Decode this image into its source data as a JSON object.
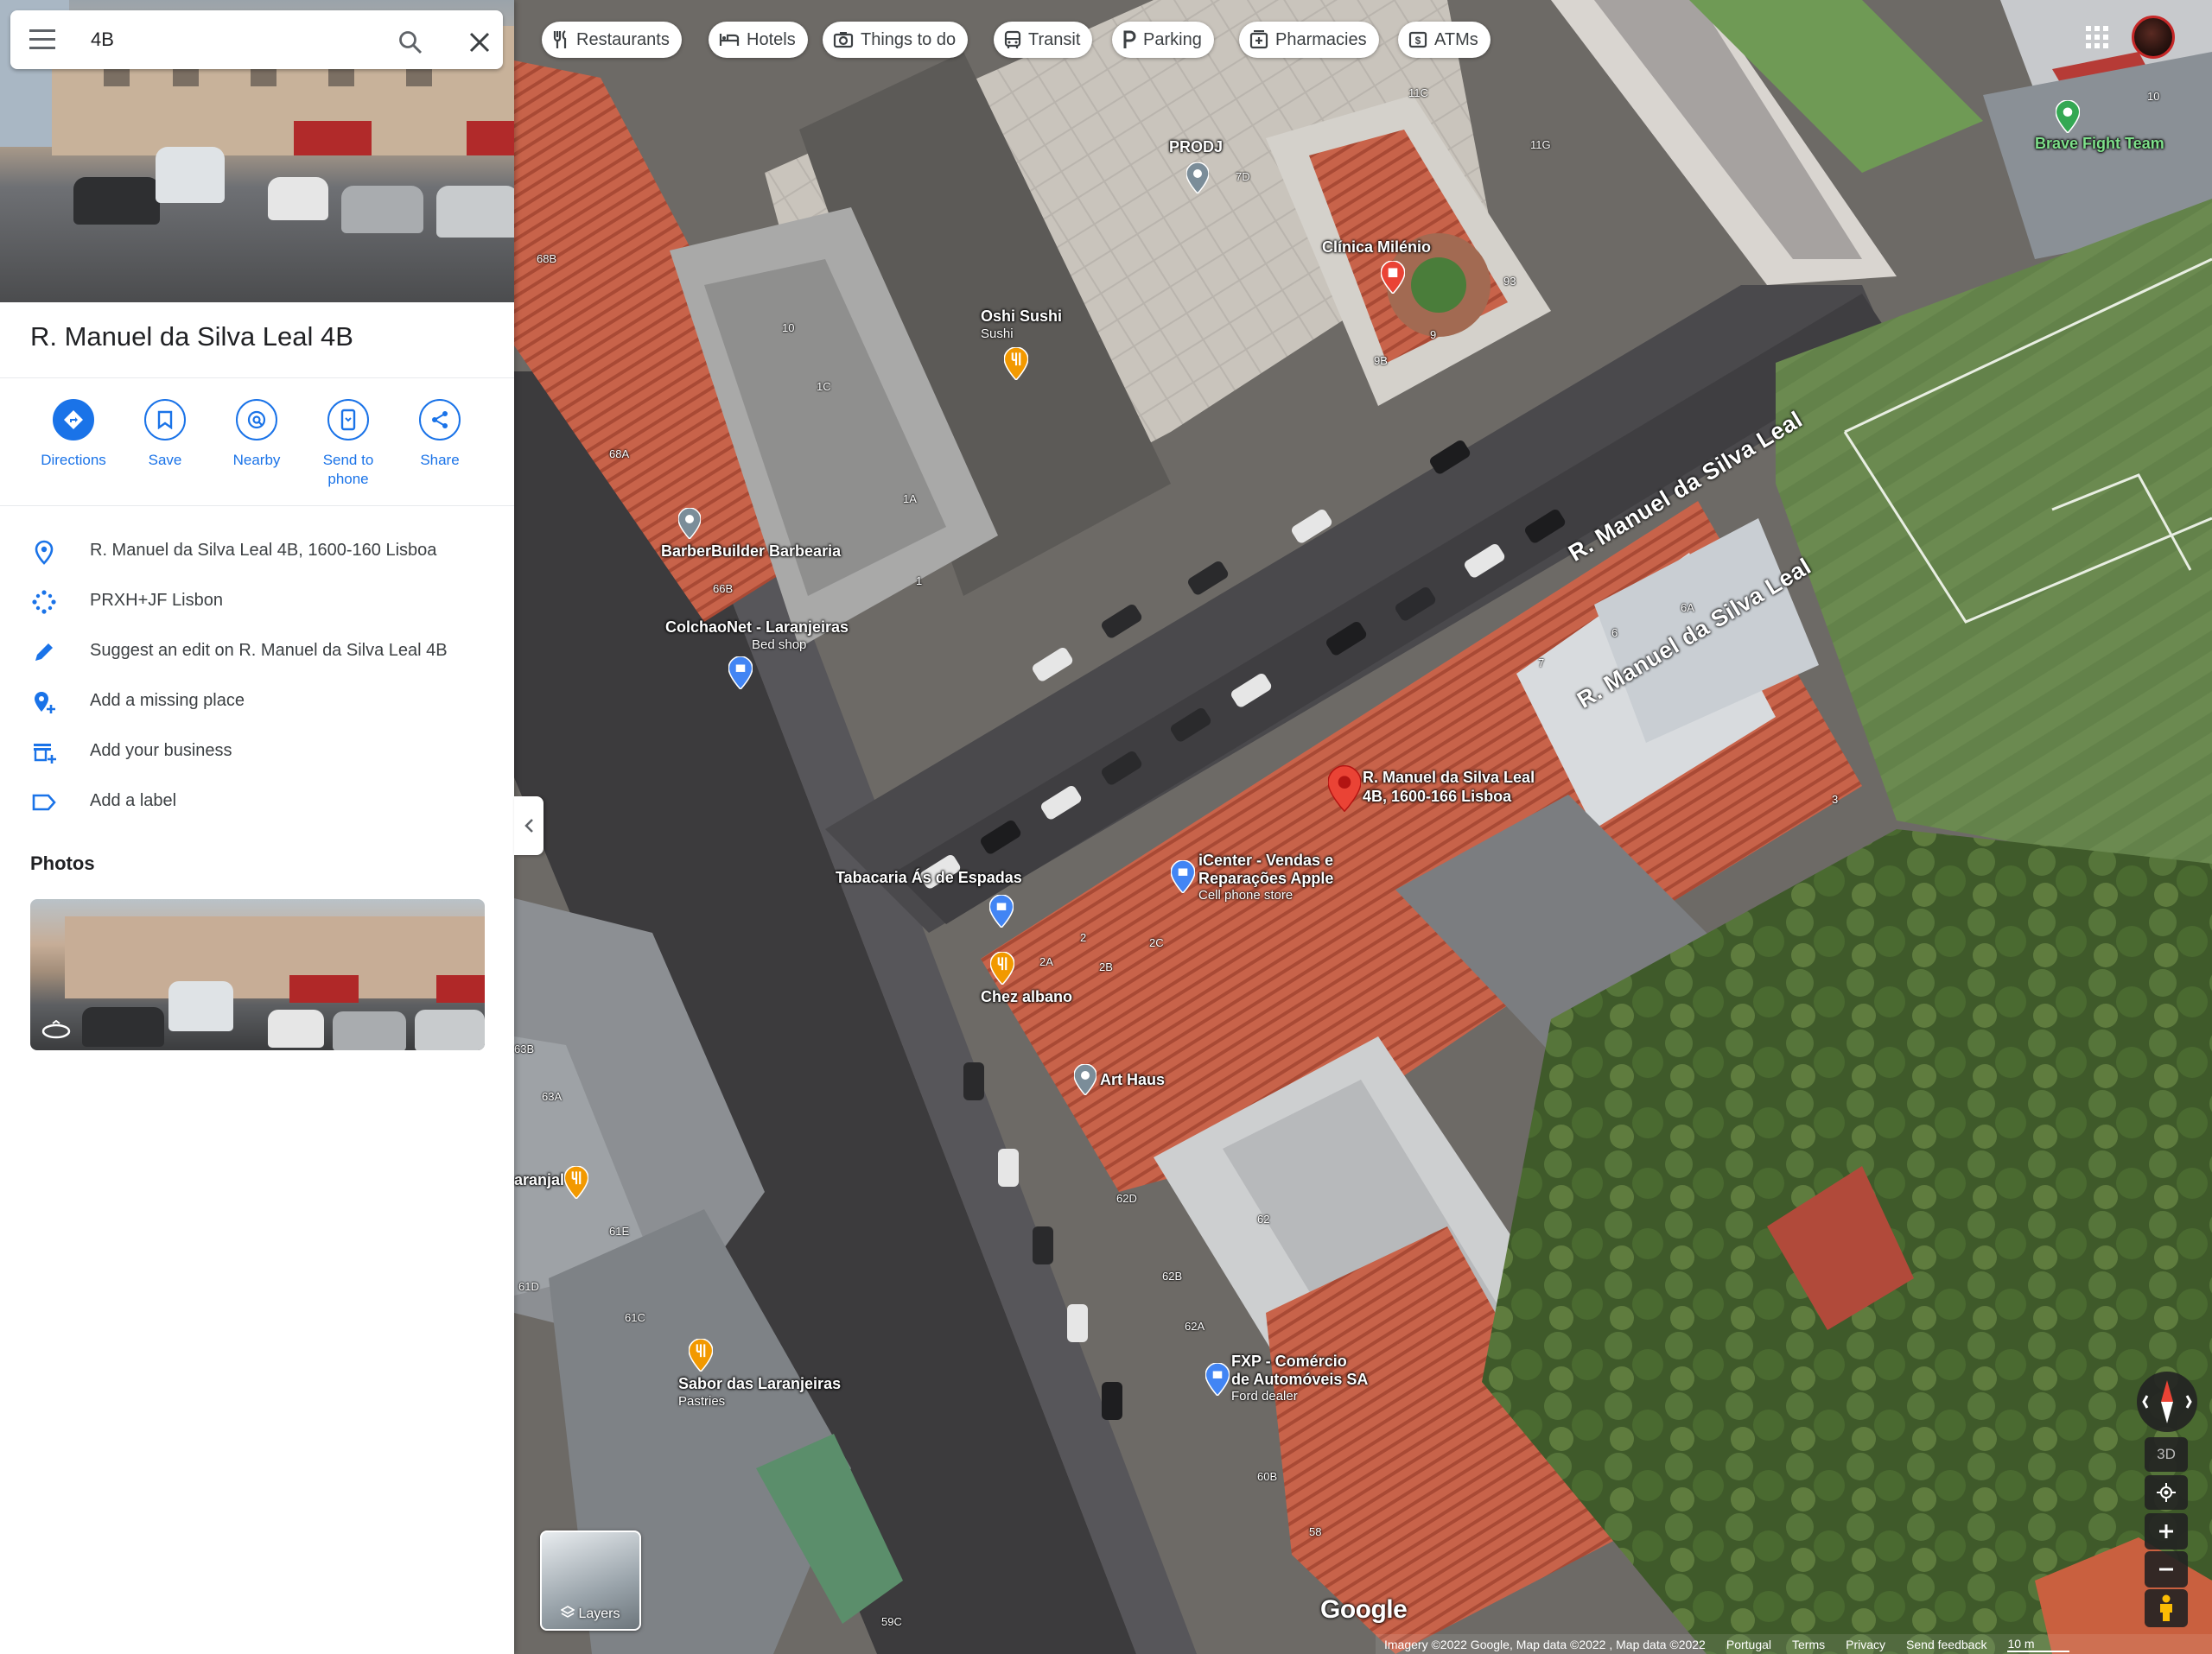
{
  "search": {
    "query": "4B"
  },
  "place": {
    "title": "R. Manuel da Silva Leal 4B"
  },
  "actions": [
    {
      "label": "Directions"
    },
    {
      "label": "Save"
    },
    {
      "label": "Nearby"
    },
    {
      "label": "Send to\nphone"
    },
    {
      "label": "Share"
    }
  ],
  "info": {
    "address": "R. Manuel da Silva Leal 4B, 1600-160 Lisboa",
    "plus_code": "PRXH+JF Lisbon",
    "suggest_edit": "Suggest an edit on R. Manuel da Silva Leal 4B",
    "add_missing_place": "Add a missing place",
    "add_business": "Add your business",
    "add_label": "Add a label"
  },
  "photos": {
    "heading": "Photos"
  },
  "chips": [
    {
      "label": "Restaurants",
      "icon": "fork-knife-icon"
    },
    {
      "label": "Hotels",
      "icon": "bed-icon"
    },
    {
      "label": "Things to do",
      "icon": "camera-icon"
    },
    {
      "label": "Transit",
      "icon": "bus-icon"
    },
    {
      "label": "Parking",
      "icon": "parking-icon"
    },
    {
      "label": "Pharmacies",
      "icon": "pharmacy-icon"
    },
    {
      "label": "ATMs",
      "icon": "atm-icon"
    }
  ],
  "map": {
    "selected_pin": {
      "line1": "R. Manuel da Silva Leal",
      "line2": "4B, 1600-166 Lisboa"
    },
    "streets": [
      "R. Manuel da Silva Leal",
      "R. Manuel da Silva Leal"
    ],
    "pois": [
      {
        "name": "PRODJ",
        "sub": ""
      },
      {
        "name": "Clínica Milénio",
        "sub": ""
      },
      {
        "name": "Oshi Sushi",
        "sub": "Sushi"
      },
      {
        "name": "BarberBuilder Barbearia",
        "sub": ""
      },
      {
        "name": "ColchaoNet - Laranjeiras",
        "sub": "Bed shop"
      },
      {
        "name": "Tabacaria Ás de Espadas",
        "sub": ""
      },
      {
        "name": "iCenter - Vendas e",
        "sub": "Cell phone store",
        "line2": "Reparações Apple"
      },
      {
        "name": "Chez albano",
        "sub": ""
      },
      {
        "name": "Art Haus",
        "sub": ""
      },
      {
        "name": "aranjal",
        "sub": ""
      },
      {
        "name": "Sabor das Laranjeiras",
        "sub": "Pastries"
      },
      {
        "name": "FXP - Comércio",
        "sub": "Ford dealer",
        "line2": "de Automóveis SA"
      },
      {
        "name": "Brave Fight Team",
        "sub": ""
      }
    ],
    "house_numbers": [
      "10",
      "1C",
      "1A",
      "1",
      "68A",
      "66B",
      "11C",
      "11G",
      "7D",
      "9B",
      "9",
      "93",
      "6",
      "6A",
      "7",
      "3",
      "2",
      "2C",
      "2A",
      "2B",
      "62D",
      "62",
      "62B",
      "62A",
      "63B",
      "63A",
      "61E",
      "61D",
      "61C",
      "60B",
      "58",
      "59C",
      "68B",
      "10"
    ],
    "colors": {
      "water_marker": "#1a73e8",
      "pin_red": "#ea4335",
      "food": "#f29900",
      "shop": "#4285f4",
      "service": "#7b8d99",
      "sport": "#34a853"
    }
  },
  "layers_label": "Layers",
  "controls": {
    "threed": "3D"
  },
  "google_logo": "Google",
  "footer": {
    "attribution": "Imagery ©2022 Google, Map data ©2022 , Map data ©2022",
    "country": "Portugal",
    "terms": "Terms",
    "privacy": "Privacy",
    "feedback": "Send feedback",
    "scale": "10 m"
  }
}
